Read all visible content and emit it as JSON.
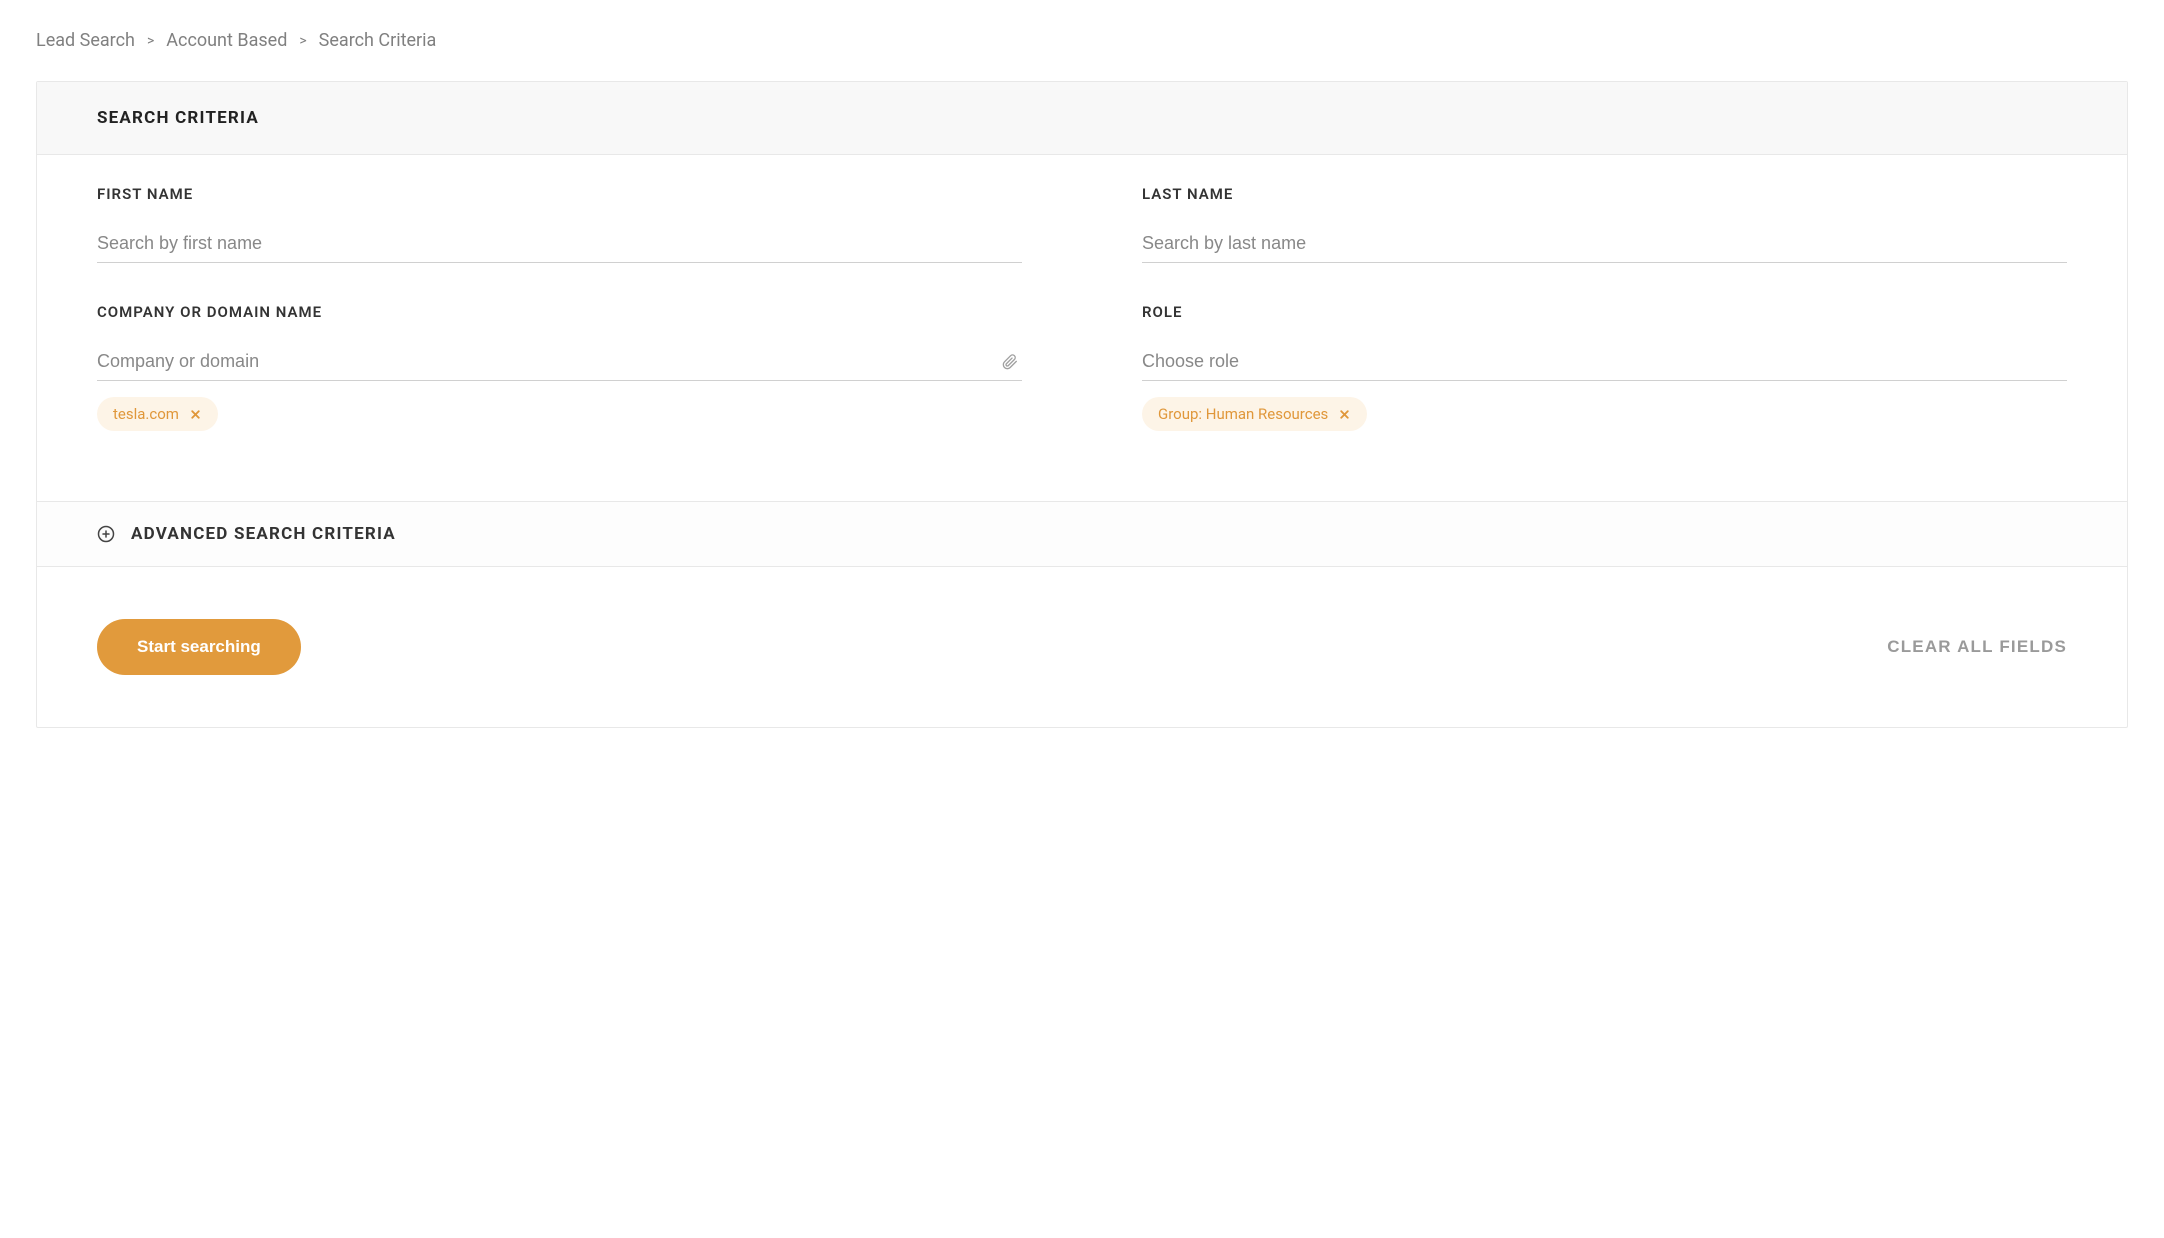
{
  "breadcrumb": {
    "items": [
      "Lead Search",
      "Account Based",
      "Search Criteria"
    ],
    "separator": ">"
  },
  "card": {
    "title": "SEARCH CRITERIA"
  },
  "fields": {
    "first_name": {
      "label": "FIRST NAME",
      "placeholder": "Search by first name",
      "value": ""
    },
    "last_name": {
      "label": "LAST NAME",
      "placeholder": "Search by last name",
      "value": ""
    },
    "company": {
      "label": "COMPANY OR DOMAIN NAME",
      "placeholder": "Company or domain",
      "value": "",
      "chips": [
        "tesla.com"
      ]
    },
    "role": {
      "label": "ROLE",
      "placeholder": "Choose role",
      "value": "",
      "chips": [
        "Group: Human Resources"
      ]
    }
  },
  "advanced": {
    "label": "ADVANCED SEARCH CRITERIA"
  },
  "footer": {
    "submit_label": "Start searching",
    "clear_label": "CLEAR ALL FIELDS"
  }
}
